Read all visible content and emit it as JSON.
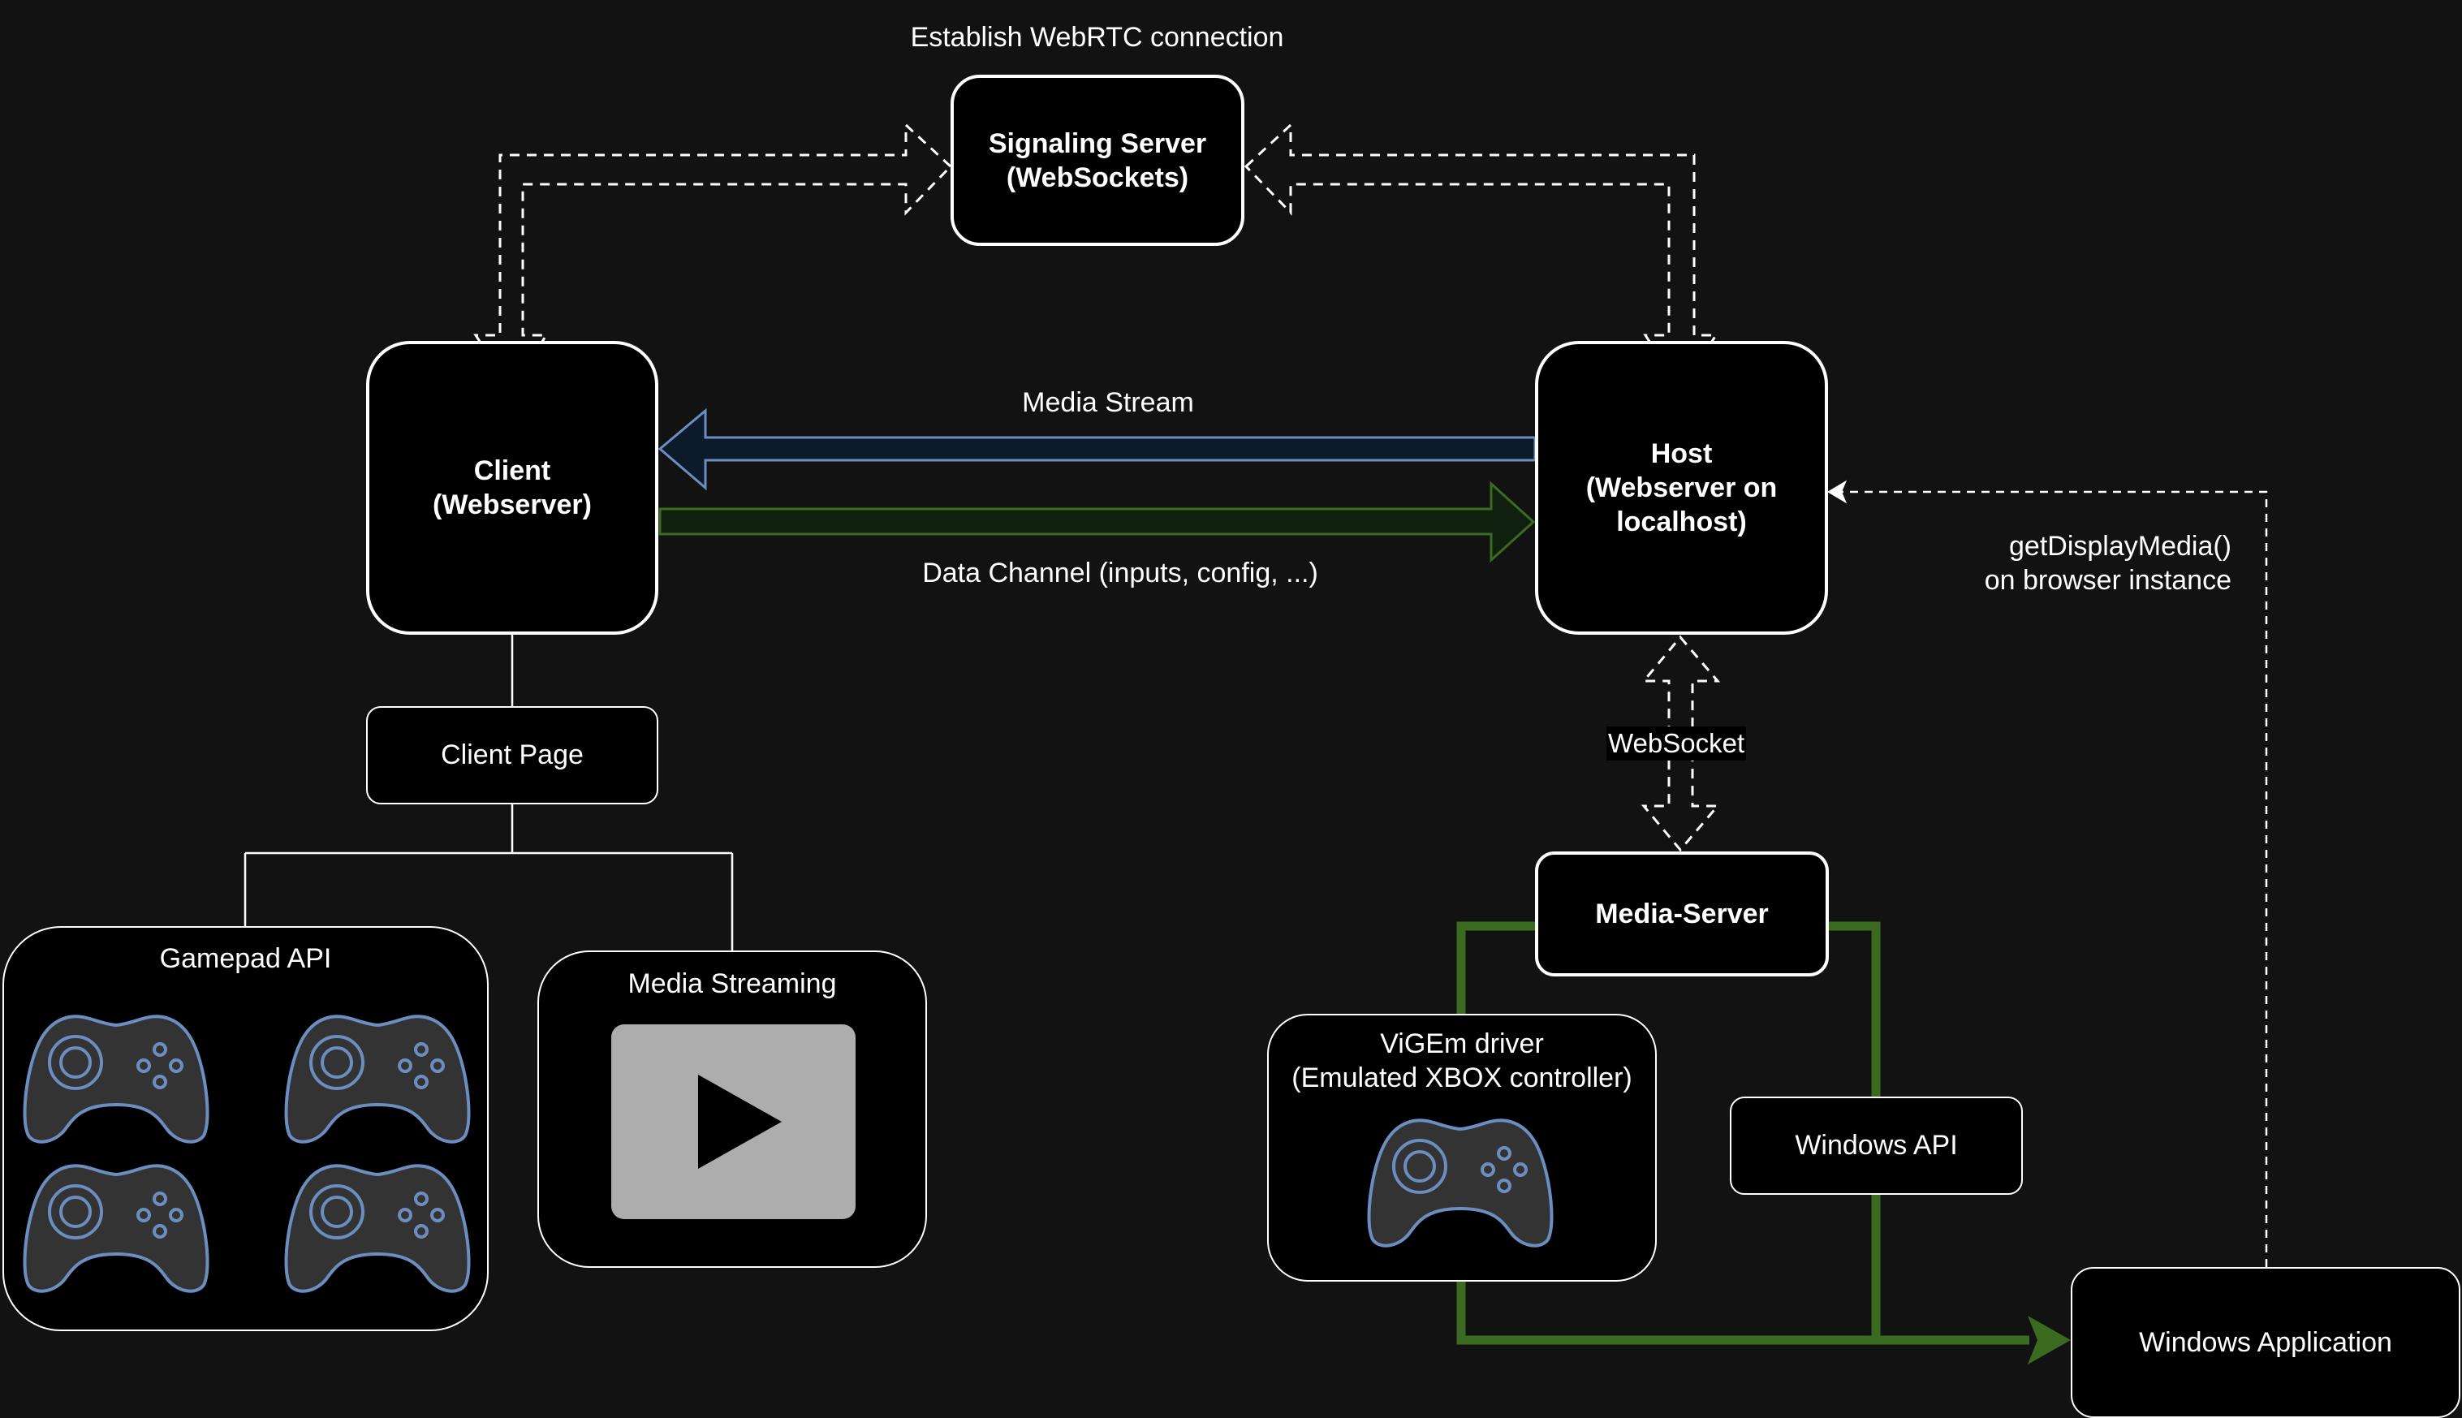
{
  "diagram": {
    "title_annotation": "Establish WebRTC connection",
    "nodes": {
      "signaling_server": {
        "line1": "Signaling Server",
        "line2": "(WebSockets)"
      },
      "client": {
        "line1": "Client",
        "line2": "(Webserver)"
      },
      "host": {
        "line1": "Host",
        "line2": "(Webserver on",
        "line3": "localhost)"
      },
      "client_page": {
        "label": "Client Page"
      },
      "gamepad_api": {
        "title": "Gamepad API",
        "gamepad_count": 4,
        "icon": "gamepad-icon"
      },
      "media_streaming": {
        "title": "Media Streaming",
        "icon": "play-video-icon"
      },
      "media_server": {
        "label": "Media-Server"
      },
      "vigem_driver": {
        "line1": "ViGEm driver",
        "line2": "(Emulated XBOX controller)",
        "icon": "gamepad-icon"
      },
      "windows_api": {
        "label": "Windows API"
      },
      "windows_application": {
        "label": "Windows Application"
      }
    },
    "edges": {
      "media_stream": {
        "label": "Media Stream",
        "from": "Host",
        "to": "Client",
        "style": "block-arrow"
      },
      "data_channel": {
        "label": "Data Channel (inputs, config, ...)",
        "from": "Client",
        "to": "Host",
        "style": "block-arrow"
      },
      "websocket": {
        "label": "WebSocket",
        "from": "Host",
        "to": "Media-Server",
        "style": "dashed-double-arrow"
      },
      "get_display_media": {
        "line1": "getDisplayMedia()",
        "line2": "on browser instance",
        "from": "Windows Application",
        "to": "Host",
        "style": "dashed"
      },
      "signaling_client": {
        "from": "Signaling Server",
        "to": "Client",
        "style": "dashed-double-arrow"
      },
      "signaling_host": {
        "from": "Signaling Server",
        "to": "Host",
        "style": "dashed-double-arrow"
      },
      "media_server_to_app": {
        "from": "Media-Server",
        "to": "Windows Application",
        "via": [
          "ViGEm driver",
          "Windows API"
        ],
        "style": "solid-green"
      }
    },
    "colors": {
      "background": "#121212",
      "node_fill": "#000000",
      "node_stroke": "#ffffff",
      "media_stream_stroke": "#6c8ebf",
      "media_stream_fill": "#0d1a2b",
      "data_channel_stroke": "#3a6b20",
      "data_channel_fill": "#10200e",
      "green_path": "#3a6b20",
      "gamepad_fill": "#333333",
      "gamepad_stroke": "#6c8ebf",
      "video_screen": "#adadad"
    }
  }
}
